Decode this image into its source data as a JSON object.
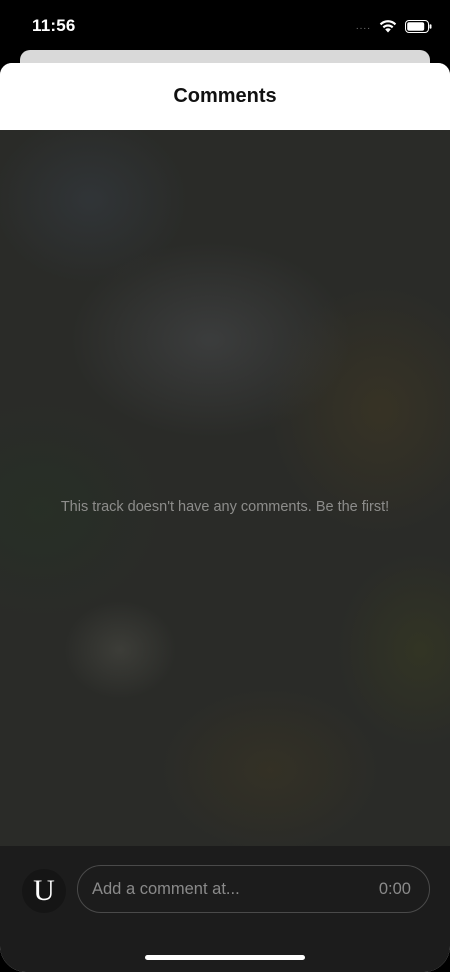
{
  "status_bar": {
    "time": "11:56",
    "signal": "....",
    "wifi_icon": "wifi-icon",
    "battery_icon": "battery-icon"
  },
  "sheet": {
    "title": "Comments"
  },
  "empty_state": {
    "message": "This track doesn't have any comments. Be the first!"
  },
  "composer": {
    "avatar_letter": "U",
    "placeholder": "Add a comment at...",
    "timestamp": "0:00"
  },
  "colors": {
    "sheet_bg": "#ffffff",
    "content_bg": "#2a2b28",
    "composer_bg": "#1c1c1c"
  }
}
